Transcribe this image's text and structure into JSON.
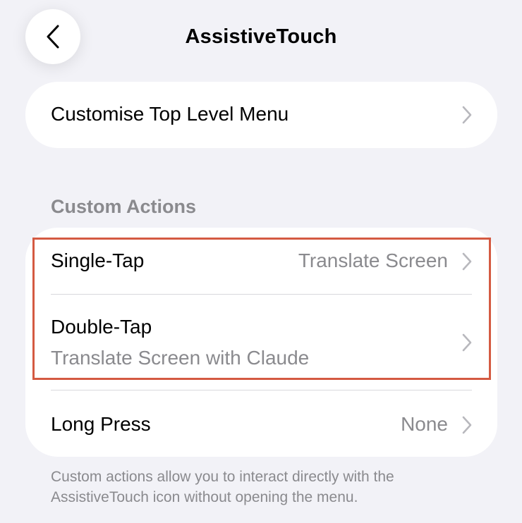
{
  "nav": {
    "title": "AssistiveTouch"
  },
  "top_menu": {
    "label": "Customise Top Level Menu"
  },
  "custom_actions": {
    "header": "Custom Actions",
    "rows": [
      {
        "label": "Single-Tap",
        "value": "Translate Screen"
      },
      {
        "label": "Double-Tap",
        "value": "Translate Screen with Claude"
      },
      {
        "label": "Long Press",
        "value": "None"
      }
    ],
    "footer": "Custom actions allow you to interact directly with the AssistiveTouch icon without opening the menu."
  },
  "colors": {
    "background": "#f2f2f7",
    "card": "#ffffff",
    "secondary_text": "#8a8a8e",
    "chevron": "#b8b8bd",
    "highlight": "#d45a42"
  },
  "icons": {
    "back": "chevron-left-icon",
    "disclosure": "chevron-right-icon"
  }
}
